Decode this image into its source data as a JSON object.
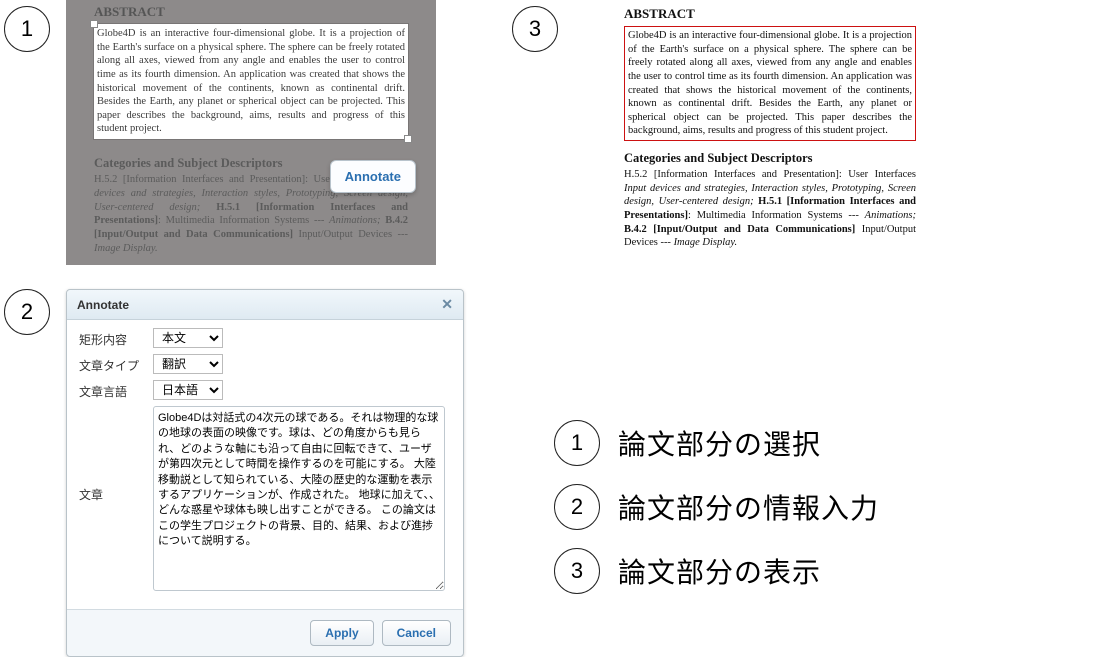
{
  "badges": {
    "b1": "1",
    "b2": "2",
    "b3": "3"
  },
  "paper": {
    "abstract_heading": "ABSTRACT",
    "abstract_text": "Globe4D is an interactive four-dimensional globe. It is a projection of the Earth's surface on a physical sphere. The sphere can be freely rotated along all axes, viewed from any angle and enables the user to control time as its fourth dimension. An application was created that shows the historical movement of the continents, known as continental drift. Besides the Earth, any planet or spherical object can be projected. This paper describes the background, aims, results and progress of this student project.",
    "categories_heading": "Categories and Subject Descriptors",
    "categories_body_html": "H.5.2 [Information Interfaces and Presentation]: User Interfaces <span class=\"ital\">Input devices and strategies, Interaction styles, Prototyping, Screen design, User-centered design;</span> <span class=\"bold\">H.5.1 [Information Interfaces and Presentations]</span>: Multimedia Information Systems --- <span class=\"ital\">Animations;</span> <span class=\"bold\">B.4.2 [Input/Output and Data Communications]</span>   Input/Output Devices --- <span class=\"ital\">Image Display.</span>"
  },
  "popbtn": {
    "label": "Annotate"
  },
  "dialog": {
    "title": "Annotate",
    "close_glyph": "✕",
    "rows": {
      "rect_label": "矩形内容",
      "rect_value": "本文",
      "type_label": "文章タイプ",
      "type_value": "翻訳",
      "lang_label": "文章言語",
      "lang_value": "日本語",
      "text_label": "文章",
      "text_value": "Globe4Dは対話式の4次元の球である。それは物理的な球の地球の表面の映像です。球は、どの角度からも見られ、どのような軸にも沿って自由に回転できて、ユーザが第四次元として時間を操作するのを可能にする。 大陸移動説として知られている、大陸の歴史的な運動を表示するアプリケーションが、作成された。 地球に加えて、、どんな惑星や球体も映し出すことができる。 この論文はこの学生プロジェクトの背景、目的、結果、および進捗について説明する。"
    },
    "apply": "Apply",
    "cancel": "Cancel"
  },
  "legend": {
    "l1": "論文部分の選択",
    "l2": "論文部分の情報入力",
    "l3": "論文部分の表示"
  }
}
